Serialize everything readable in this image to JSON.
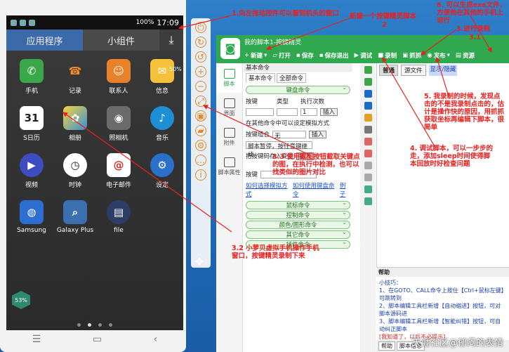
{
  "phone": {
    "status": {
      "battery": "100%",
      "time": "17:09"
    },
    "tabs": [
      {
        "label": "应用程序"
      },
      {
        "label": "小组件"
      }
    ],
    "download_icon": "download-icon",
    "apps": [
      {
        "label": "手机",
        "icon": "phone-icon",
        "color": "#3aa84a"
      },
      {
        "label": "记录",
        "icon": "call-log-icon",
        "color": "#ffffff"
      },
      {
        "label": "联系人",
        "icon": "contacts-icon",
        "color": "#e8822a"
      },
      {
        "label": "信息",
        "icon": "messages-icon",
        "color": "#f3c23a"
      },
      {
        "label": "S日历",
        "icon": "calendar-icon",
        "color": "#ffffff"
      },
      {
        "label": "相册",
        "icon": "gallery-icon",
        "color": "#f1c40f"
      },
      {
        "label": "照相机",
        "icon": "camera-icon",
        "color": "#555555"
      },
      {
        "label": "音乐",
        "icon": "music-icon",
        "color": "#1d8fd6"
      },
      {
        "label": "视频",
        "icon": "video-icon",
        "color": "#3d4dbf"
      },
      {
        "label": "时钟",
        "icon": "clock-icon",
        "color": "#ffffff"
      },
      {
        "label": "电子邮件",
        "icon": "email-icon",
        "color": "#ffffff"
      },
      {
        "label": "设定",
        "icon": "settings-icon",
        "color": "#2a6fc9"
      },
      {
        "label": "Samsung",
        "icon": "samsung-apps-icon",
        "color": "#2d6fd0"
      },
      {
        "label": "Galaxy Plus",
        "icon": "galaxy-plus-icon",
        "color": "#3b6fb0"
      },
      {
        "label": "file",
        "icon": "file-icon",
        "color": "#2c3e66"
      }
    ],
    "badge_50": "50%",
    "badge_53": "53%"
  },
  "editor": {
    "title": "我的脚本1-按键精灵",
    "toolbar": [
      "新建",
      "打开",
      "保存",
      "保存退出",
      "调试",
      "录制",
      "抓抓",
      "发布",
      "资源"
    ],
    "left_tabs": [
      "脚本",
      "界面",
      "附件",
      "脚本属性"
    ],
    "cmd": {
      "header": "基本命令",
      "tabs": [
        "基本命令",
        "全部命令"
      ],
      "keyboard_group": "键盘命令",
      "key_label": "按键",
      "type_label": "类型",
      "count_label": "执行次数",
      "count_value": "1",
      "insert": "插入",
      "other_cmd_text": "在其他命令中可以设定模拟方式",
      "combo_label": "按键组合",
      "combo_value": "无",
      "pause_text": "脚本暂停，按任意键继续",
      "key_code_text": "把按键码存入变量",
      "key_field_label": "按键",
      "link1": "如何选择模拟方式",
      "link2": "如何使用键盘命令",
      "link3": "例子",
      "groups": [
        "鼠标命令",
        "控制命令",
        "颜色/图形命令",
        "其它命令",
        "插件命令"
      ]
    },
    "script_tabs": [
      "普通",
      "源文件"
    ],
    "script_tag": "显示/隐藏",
    "help": {
      "title": "帮助",
      "heading": "小技巧：",
      "tips": [
        "1、在GOTO、CALL命令上按住【Ctrl+鼠标左键】可跳转到",
        "2、脚本编辑工具栏新增【自动缩进】按钮，可对脚本源码进",
        "3、脚本编辑工具栏新增【智能纠错】按钮，可自动纠正脚本",
        "[我知道了，以后不必提示]"
      ],
      "tabs": [
        "帮助",
        "脚本信息"
      ]
    }
  },
  "annotations": {
    "a1": "1.向左拖动控件可以看到机头的窗口",
    "a2": "新建一个按键精灵脚本",
    "a2n": "2",
    "a3": "3.进行录制",
    "a3b": "3.1",
    "a6": "6. 可以生成exe文件，方便他在其他的手机上运行",
    "a5": "5. 我录制的时候，发现点击的不是我录制点击的，估计是操作快的原因，用抓抓获取坐标再编辑下脚本，很简单",
    "a4": "4. 调试脚本，可以一步步的走，添加sleep时间使得脚本回放时好检查问题",
    "a33": "3.3 使用截图按钮截取关键点的图，在执行中检测，也可以找类似的图片对比",
    "a32": "3.2 小萝贝虚拟手机操作手机窗口，按键精灵录制下来"
  },
  "watermark": "天涯社区@郁闷的表情"
}
